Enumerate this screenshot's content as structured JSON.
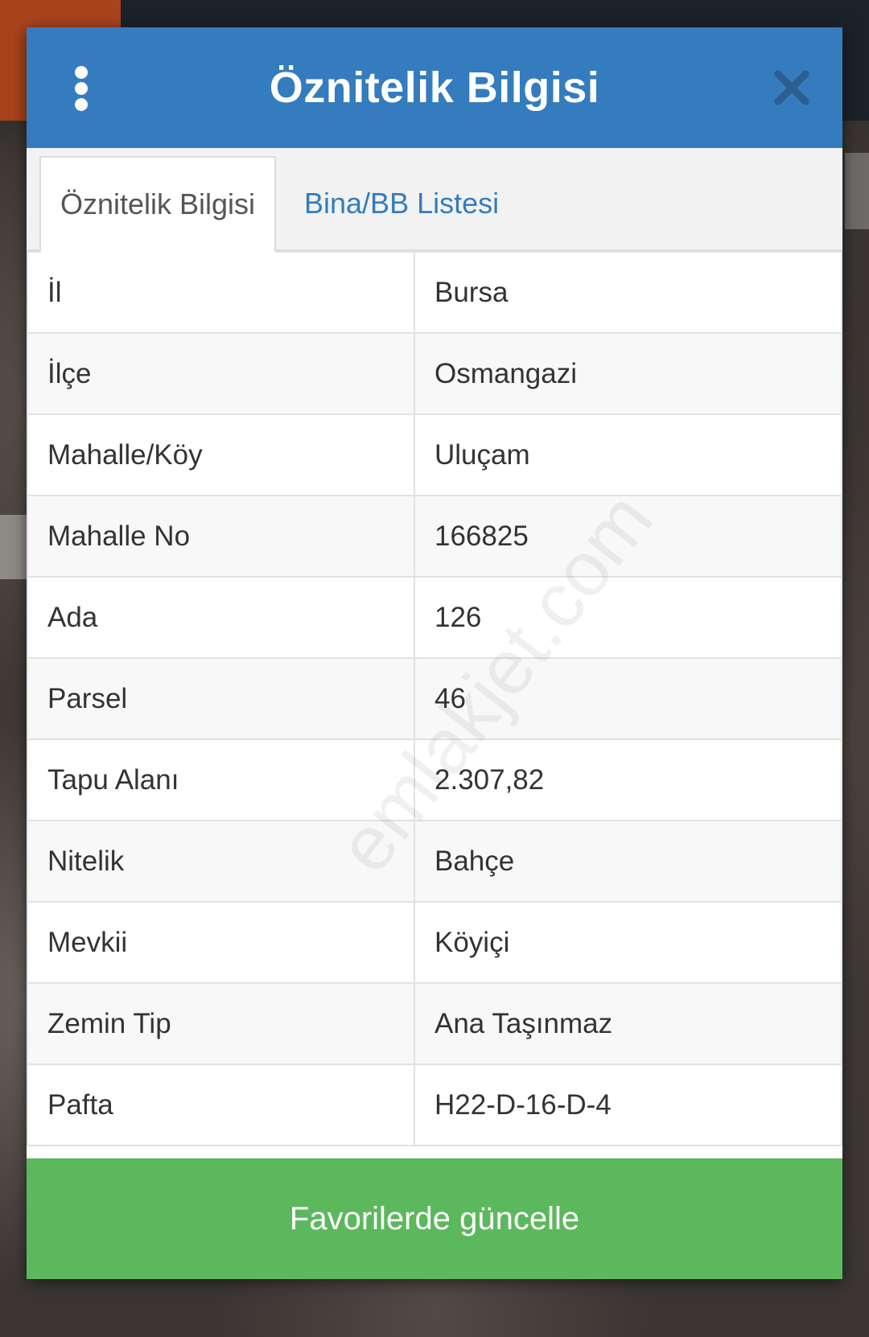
{
  "dialog": {
    "title": "Öznitelik Bilgisi",
    "menu_icon": "more-vertical-icon",
    "close_icon": "close-icon",
    "colors": {
      "header": "#347cbd",
      "footer_button": "#5cb85c",
      "tab_link": "#347cbd"
    }
  },
  "tabs": [
    {
      "label": "Öznitelik Bilgisi",
      "active": true
    },
    {
      "label": "Bina/BB Listesi",
      "active": false
    }
  ],
  "rows": [
    {
      "key": "İl",
      "value": "Bursa"
    },
    {
      "key": "İlçe",
      "value": "Osmangazi"
    },
    {
      "key": "Mahalle/Köy",
      "value": "Uluçam"
    },
    {
      "key": "Mahalle No",
      "value": "166825"
    },
    {
      "key": "Ada",
      "value": "126"
    },
    {
      "key": "Parsel",
      "value": "46"
    },
    {
      "key": "Tapu Alanı",
      "value": "2.307,82"
    },
    {
      "key": "Nitelik",
      "value": "Bahçe"
    },
    {
      "key": "Mevkii",
      "value": "Köyiçi"
    },
    {
      "key": "Zemin Tip",
      "value": "Ana Taşınmaz"
    },
    {
      "key": "Pafta",
      "value": "H22-D-16-D-4"
    }
  ],
  "footer": {
    "button_label": "Favorilerde güncelle"
  },
  "watermark": "emlakjet.com"
}
